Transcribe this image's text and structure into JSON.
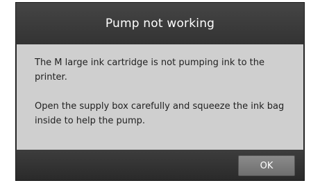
{
  "dialog": {
    "title": "Pump not working",
    "message_1": "The M large ink cartridge is not pumping ink to the printer.",
    "message_2": "Open the supply box carefully and squeeze the ink bag inside to help the pump.",
    "ok_label": "OK"
  },
  "colors": {
    "titlebar": "#3c3c3c",
    "body_background": "#cfcfcf",
    "button": "#7d7d7d",
    "text": "#222222"
  }
}
